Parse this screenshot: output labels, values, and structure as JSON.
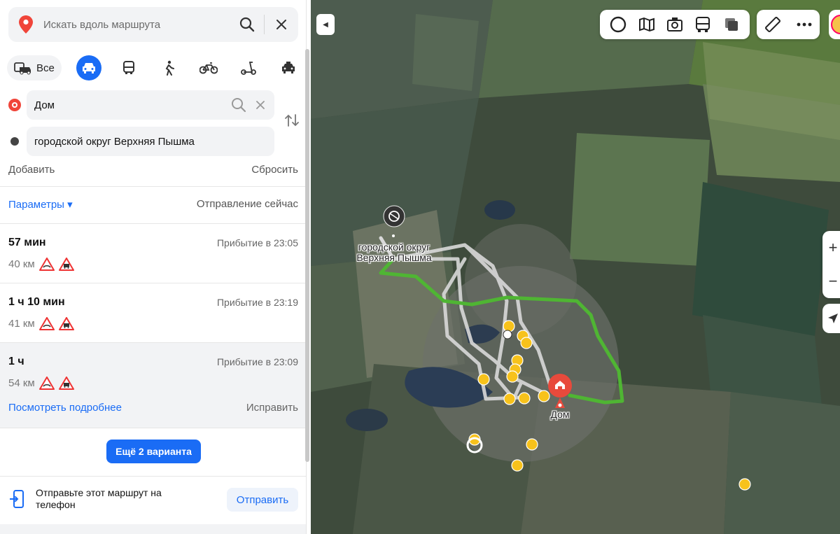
{
  "search": {
    "placeholder": "Искать вдоль маршрута"
  },
  "modes": {
    "all_label": "Все"
  },
  "waypoints": {
    "from": "Дом",
    "to": "городской округ Верхняя Пышма"
  },
  "actions": {
    "add": "Добавить",
    "reset": "Сбросить"
  },
  "params": {
    "label": "Параметры ▾",
    "departure": "Отправление сейчас"
  },
  "routes": [
    {
      "time": "57 мин",
      "arrival": "Прибытие в 23:05",
      "distance": "40 км"
    },
    {
      "time": "1 ч 10 мин",
      "arrival": "Прибытие в 23:19",
      "distance": "41 км"
    },
    {
      "time": "1 ч",
      "arrival": "Прибытие в 23:09",
      "distance": "54 км",
      "details": "Посмотреть подробнее",
      "fix": "Исправить"
    }
  ],
  "more_variants": "Ещё 2 варианта",
  "send": {
    "text": "Отправьте этот маршрут на телефон",
    "button": "Отправить"
  },
  "map": {
    "label_destination": "городской округ\nВерхняя Пышма",
    "label_home": "Дом",
    "route_color": "#4fb533",
    "alt_route_color": "#d9d9d9",
    "home_marker_color": "#e84a3c",
    "poi_color": "#f7c21b"
  }
}
